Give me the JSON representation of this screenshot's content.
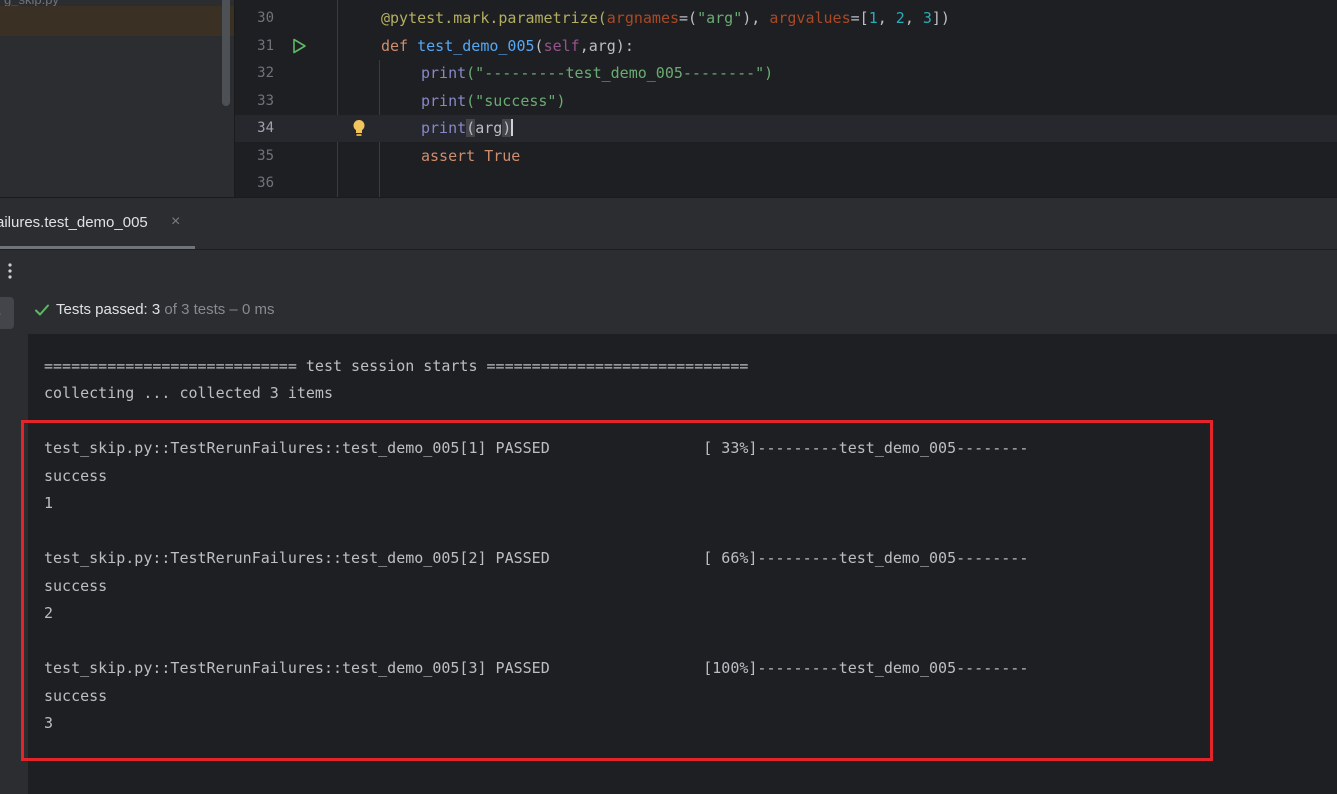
{
  "editor": {
    "lines": [
      {
        "num": "30"
      },
      {
        "num": "31"
      },
      {
        "num": "32"
      },
      {
        "num": "33"
      },
      {
        "num": "34"
      },
      {
        "num": "35"
      },
      {
        "num": "36"
      }
    ],
    "code": {
      "decorator": "@pytest.mark.parametrize(",
      "argnames_kw": "argnames",
      "eq1": "=(",
      "arg_str": "\"arg\"",
      "close1": "), ",
      "argvalues_kw": "argvalues",
      "eq2": "=[",
      "n1": "1",
      "comma1": ", ",
      "n2": "2",
      "comma2": ", ",
      "n3": "3",
      "close2": "])",
      "def_kw": "def ",
      "func_name": "test_demo_005",
      "paren_open": "(",
      "self_kw": "self",
      "params_rest": ",arg):",
      "print1_fn": "print",
      "print1_arg": "(\"---------test_demo_005--------\")",
      "print2_fn": "print",
      "print2_arg": "(\"success\")",
      "print3_fn": "print",
      "print3_open": "(",
      "print3_arg": "arg",
      "print3_close": ")",
      "assert_kw": "assert ",
      "true_kw": "True"
    }
  },
  "run_tab": {
    "label": "ailures.test_demo_005",
    "close": "×"
  },
  "side_button": {
    "label": "is"
  },
  "status": {
    "label": "Tests passed: ",
    "count": "3",
    "rest": " of 3 tests – 0 ms"
  },
  "console": {
    "lines": [
      "============================ test session starts =============================",
      "collecting ... collected 3 items",
      "test_skip.py::TestRerunFailures::test_demo_005[1] PASSED                 [ 33%]---------test_demo_005--------",
      "success",
      "1",
      "test_skip.py::TestRerunFailures::test_demo_005[2] PASSED                 [ 66%]---------test_demo_005--------",
      "success",
      "2",
      "test_skip.py::TestRerunFailures::test_demo_005[3] PASSED                 [100%]---------test_demo_005--------",
      "success",
      "3"
    ]
  },
  "colors": {
    "highlight_border": "#e3242b",
    "pass_green": "#5fb865",
    "bulb_yellow": "#f2c55c"
  }
}
